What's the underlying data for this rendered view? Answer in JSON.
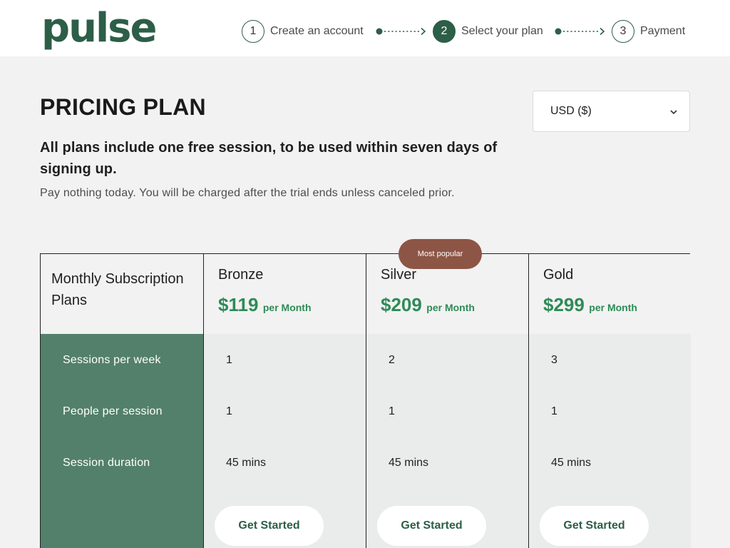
{
  "brand": {
    "logo_text": "pulse",
    "color": "#2d5e48"
  },
  "stepper": {
    "steps": [
      {
        "number": "1",
        "label": "Create an account",
        "active": false
      },
      {
        "number": "2",
        "label": "Select your plan",
        "active": true
      },
      {
        "number": "3",
        "label": "Payment",
        "active": false
      }
    ],
    "connector_icon": "dotted-arrow-icon"
  },
  "intro": {
    "title": "PRICING PLAN",
    "lead": "All plans include one free session, to be used within seven days of signing up.",
    "note": "Pay nothing today. You will be charged after the trial ends unless canceled prior."
  },
  "currency": {
    "selected": "USD ($)",
    "icon": "chevron-down-icon"
  },
  "table": {
    "header_label": "Monthly Subscription Plans",
    "row_labels": [
      "Sessions per week",
      "People per session",
      "Session duration"
    ],
    "plans": [
      {
        "name": "Bronze",
        "price": "$119",
        "period": "per Month",
        "values": [
          "1",
          "1",
          "45 mins"
        ],
        "cta": "Get Started"
      },
      {
        "name": "Silver",
        "price": "$209",
        "period": "per Month",
        "values": [
          "2",
          "1",
          "45 mins"
        ],
        "cta": "Get Started"
      },
      {
        "name": "Gold",
        "price": "$299",
        "period": "per Month",
        "values": [
          "3",
          "1",
          "45 mins"
        ],
        "cta": "Get Started"
      }
    ],
    "badge": "Most popular"
  },
  "colors": {
    "accent": "#2d5e48",
    "price": "#2e8b57",
    "label_column": "#53806a",
    "badge": "#8d5545",
    "background": "#f2f2f2"
  }
}
